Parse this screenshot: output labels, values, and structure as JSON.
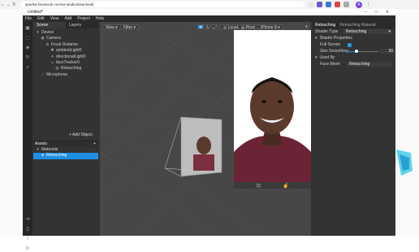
{
  "browser": {
    "url": "sparkar.facebook.com/ar-studio/download/",
    "avatar_letter": "A"
  },
  "window": {
    "title": "Untitled*"
  },
  "menu": [
    "File",
    "Edit",
    "View",
    "Add",
    "Project",
    "Help"
  ],
  "scene_panel": {
    "tabs": [
      "Scene",
      "Layers"
    ],
    "tree": [
      "Device",
      "Camera",
      "Focal Distance",
      "ambientLight0",
      "directionalLight0",
      "faceTracker0",
      "Retouching",
      "Microphone"
    ],
    "add_object": "+ Add Object"
  },
  "assets": {
    "header": "Assets",
    "items": [
      "Materials",
      "Retouching"
    ],
    "add_asset": "+"
  },
  "viewport": {
    "view": "View",
    "filter": "Filter",
    "local": "Local",
    "pivot": "Pivot",
    "device": "iPhone 8"
  },
  "inspector": {
    "title": "Retouching",
    "subtitle": "Retouching Material",
    "shader_type_label": "Shader Type",
    "shader_type_value": "Retouching",
    "shader_properties": "Shader Properties",
    "full_screen": "Full Screen",
    "skin_smoothing": "Skin Smoothing",
    "skin_smoothing_value": "30",
    "used_by": "Used By",
    "face_mesh": "Face Mesh",
    "face_mesh_value": "Retouching"
  }
}
